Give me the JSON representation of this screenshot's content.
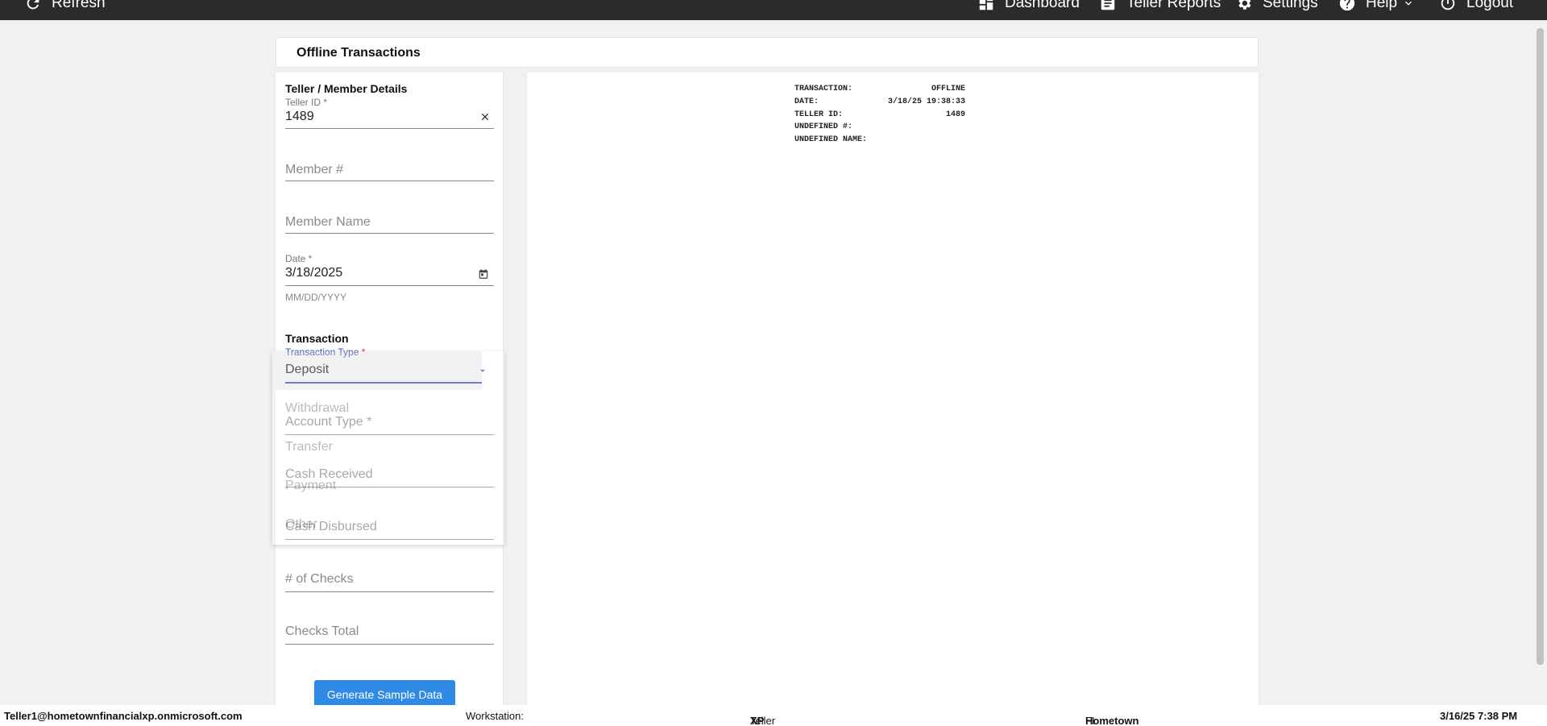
{
  "nav": {
    "refresh": "Refresh",
    "dashboard": "Dashboard",
    "teller_reports": "Teller Reports",
    "settings": "Settings",
    "help": "Help",
    "logout": "Logout"
  },
  "page": {
    "title": "Offline Transactions"
  },
  "details": {
    "title": "Teller / Member Details",
    "teller_id_label": "Teller ID *",
    "teller_id_value": "1489",
    "member_number_placeholder": "Member #",
    "member_name_placeholder": "Member Name",
    "date_label": "Date *",
    "date_value": "3/18/2025",
    "date_helper": "MM/DD/YYYY"
  },
  "transaction": {
    "title": "Transaction",
    "type_label": "Transaction Type",
    "type_required": " *",
    "type_value": "Deposit",
    "options": [
      "Withdrawal",
      "Transfer",
      "Payment",
      "Other"
    ],
    "account_type_placeholder": "Account Type *",
    "cash_received_placeholder": "Cash Received",
    "cash_disbursed_placeholder": "Cash Disbursed",
    "num_checks_placeholder": "# of Checks",
    "checks_total_placeholder": "Checks Total",
    "generate_button": "Generate Sample Data"
  },
  "receipt": {
    "rows": [
      {
        "label": "TRANSACTION:",
        "value": "OFFLINE"
      },
      {
        "label": "DATE:",
        "value": "3/18/25 19:38:33"
      },
      {
        "label": "TELLER ID:",
        "value": "1489"
      },
      {
        "label": "UNDEFINED #:",
        "value": ""
      },
      {
        "label": "UNDEFINED NAME:",
        "value": ""
      }
    ]
  },
  "status": {
    "user": "Teller1@hometownfinancialxp.onmicrosoft.com",
    "workstation_label": "Workstation:",
    "platform_label": "Teller Platform:",
    "platform_value": "XP",
    "fi_label": "FI:",
    "fi_value": "Hometown Financial XP",
    "datetime": "3/16/25 7:38 PM"
  },
  "colors": {
    "topbar": "#2b2b2b",
    "accent": "#3f51b5",
    "button": "#2f8ae5"
  },
  "icons": {
    "refresh": "refresh-icon",
    "dashboard": "dashboard-icon",
    "reports": "report-icon",
    "settings": "gear-icon",
    "help": "help-icon",
    "logout": "power-icon"
  }
}
